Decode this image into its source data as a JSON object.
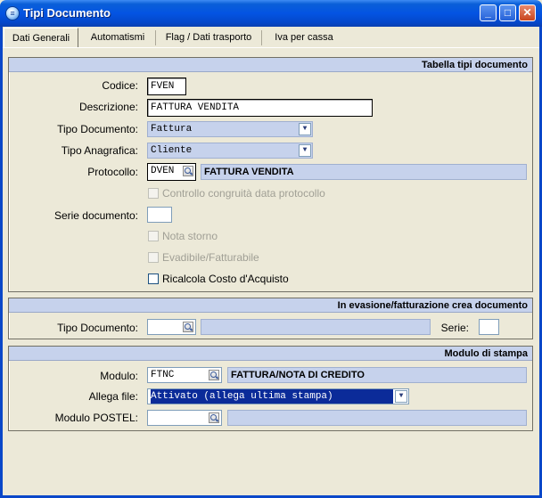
{
  "window": {
    "title": "Tipi Documento"
  },
  "tabs": [
    "Dati Generali",
    "Automatismi",
    "Flag / Dati trasporto",
    "Iva per cassa"
  ],
  "section1": {
    "header": "Tabella tipi documento",
    "codice_label": "Codice:",
    "codice_value": "FVEN",
    "descrizione_label": "Descrizione:",
    "descrizione_value": "FATTURA VENDITA",
    "tipo_documento_label": "Tipo Documento:",
    "tipo_documento_value": "Fattura",
    "tipo_anagrafica_label": "Tipo Anagrafica:",
    "tipo_anagrafica_value": "Cliente",
    "protocollo_label": "Protocollo:",
    "protocollo_value": "DVEN",
    "protocollo_desc": "FATTURA VENDITA",
    "controllo_label": "Controllo congruità data protocollo",
    "serie_label": "Serie documento:",
    "serie_value": "",
    "nota_storno_label": "Nota storno",
    "evadibile_label": "Evadibile/Fatturabile",
    "ricalcola_label": "Ricalcola Costo d'Acquisto"
  },
  "section2": {
    "header": "In evasione/fatturazione crea documento",
    "tipo_documento_label": "Tipo Documento:",
    "tipo_documento_value": "",
    "tipo_documento_desc": "",
    "serie_label": "Serie:",
    "serie_value": ""
  },
  "section3": {
    "header": "Modulo di stampa",
    "modulo_label": "Modulo:",
    "modulo_value": "FTNC",
    "modulo_desc": "FATTURA/NOTA DI CREDITO",
    "allega_label": "Allega file:",
    "allega_value": "Attivato (allega ultima stampa)",
    "postel_label": "Modulo POSTEL:",
    "postel_value": "",
    "postel_desc": ""
  },
  "icons": {
    "app": "app-icon",
    "minimize": "minimize-icon",
    "maximize": "maximize-icon",
    "close": "close-icon",
    "lookup": "magnifier-icon",
    "dropdown": "chevron-down-icon"
  },
  "colors": {
    "titlebar": "#0454e2",
    "section_header": "#c6d2ec",
    "selection": "#0b2b99",
    "background": "#ece9d8"
  }
}
